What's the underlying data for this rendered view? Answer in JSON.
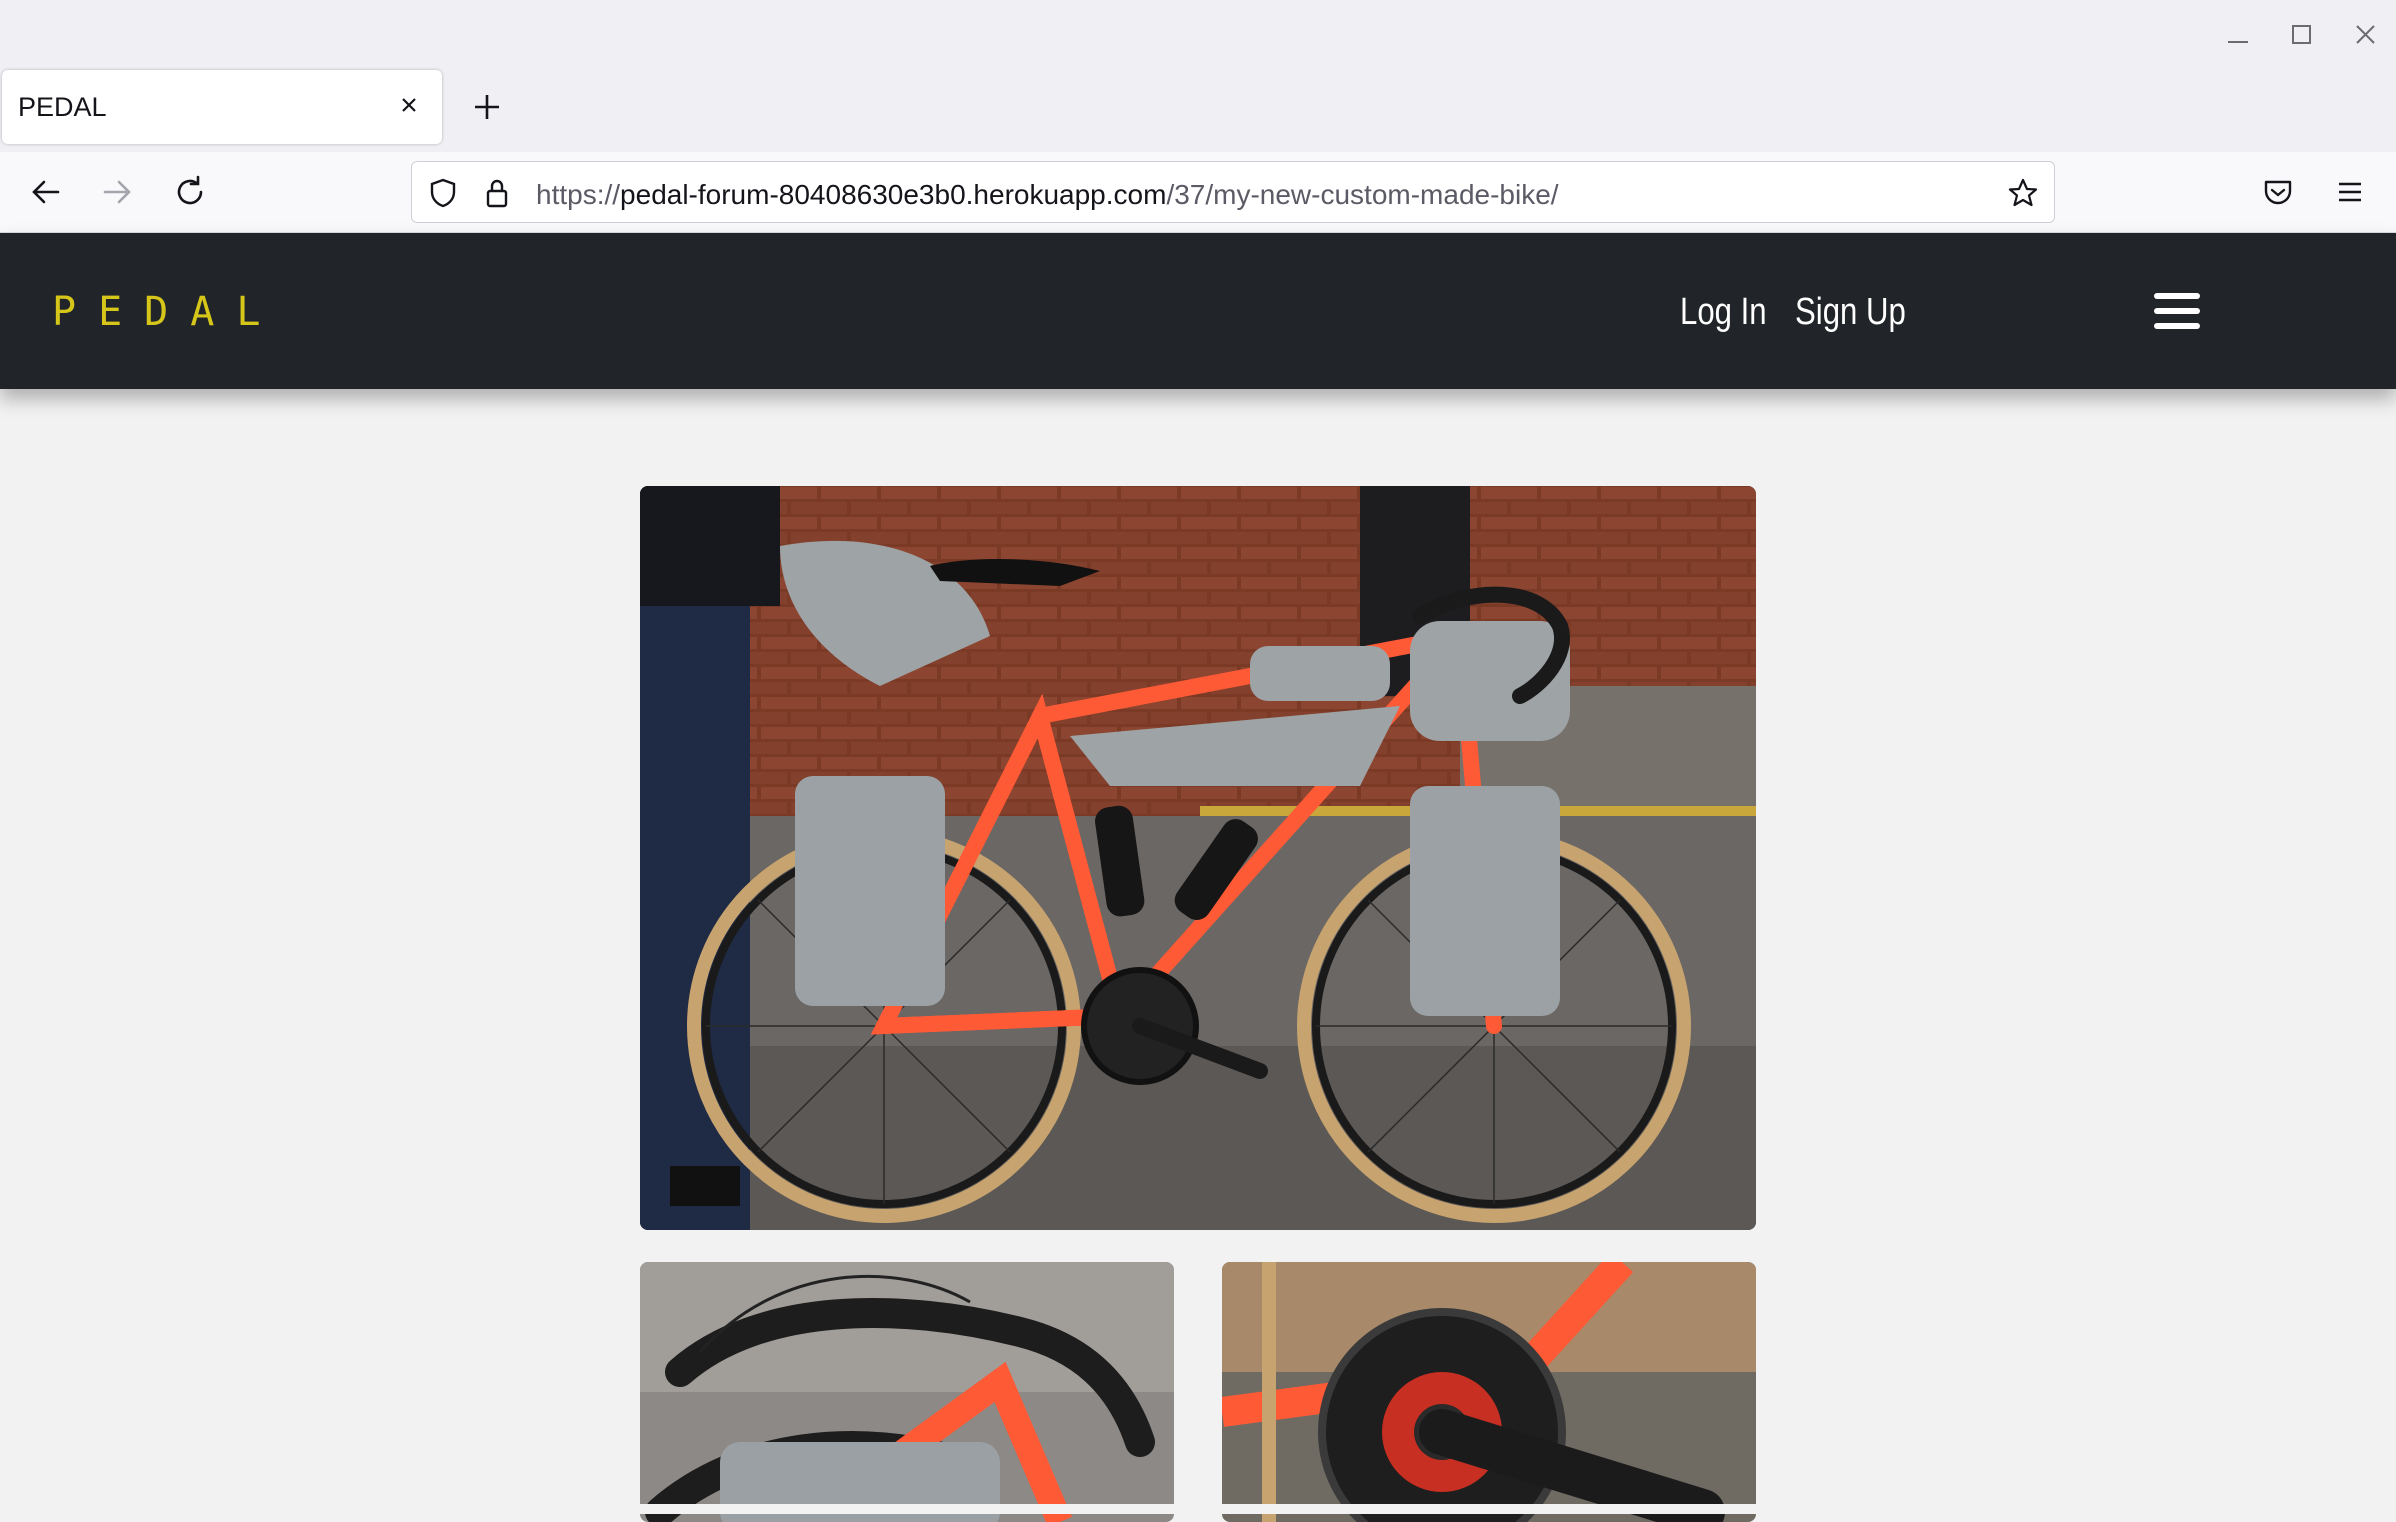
{
  "browser": {
    "tab_title": "PEDAL",
    "url_scheme": "https://",
    "url_host": "pedal-forum-80408630e3b0.herokuapp.com",
    "url_path": "/37/my-new-custom-made-bike/",
    "icons": [
      "minimize-icon",
      "maximize-icon",
      "close-window-icon",
      "close-tab-icon",
      "new-tab-icon",
      "back-icon",
      "forward-icon",
      "reload-icon",
      "shield-icon",
      "lock-icon",
      "bookmark-star-icon",
      "pocket-icon",
      "menu-icon"
    ]
  },
  "site": {
    "logo": "PEDAL",
    "nav": {
      "login": "Log In",
      "signup": "Sign Up"
    },
    "colors": {
      "header_bg": "#212529",
      "logo": "#d6c619",
      "page_bg": "#f2f2f2",
      "bike_frame": "#ff5a36"
    }
  },
  "gallery": {
    "images": [
      "bike-main-photo",
      "handlebar-detail-photo",
      "crankset-detail-photo"
    ]
  }
}
